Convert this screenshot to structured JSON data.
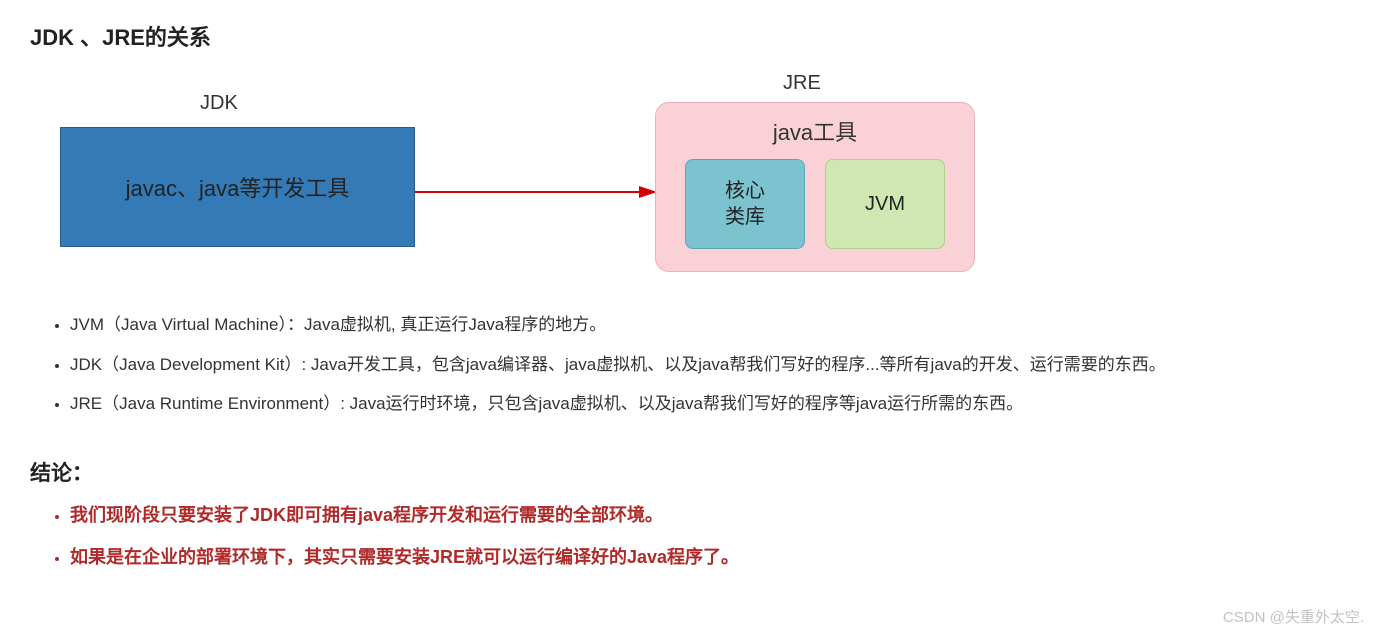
{
  "title": "JDK 、JRE的关系",
  "diagram": {
    "jdk_label": "JDK",
    "jre_label": "JRE",
    "jdk_box_text": "javac、java等开发工具",
    "jre_box": {
      "heading": "java工具",
      "core_lib": "核心\n类库",
      "jvm": "JVM"
    }
  },
  "definitions": [
    "JVM（Java Virtual Machine）：Java虚拟机, 真正运行Java程序的地方。",
    "JDK（Java Development Kit）: Java开发工具，包含java编译器、java虚拟机、以及java帮我们写好的程序...等所有java的开发、运行需要的东西。",
    "JRE（Java Runtime Environment）: Java运行时环境，只包含java虚拟机、以及java帮我们写好的程序等java运行所需的东西。"
  ],
  "conclusion_title": "结论：",
  "conclusions": [
    "我们现阶段只要安装了JDK即可拥有java程序开发和运行需要的全部环境。",
    "如果是在企业的部署环境下，其实只需要安装JRE就可以运行编译好的Java程序了。"
  ],
  "watermark": "CSDN @失重外太空.",
  "colors": {
    "jdk_box": "#337ab7",
    "jre_box": "#f9d1d6",
    "core_lib": "#7cc3cf",
    "jvm": "#cfe8b3",
    "arrow": "#d40000",
    "conclusion_text": "#b02a2a"
  }
}
